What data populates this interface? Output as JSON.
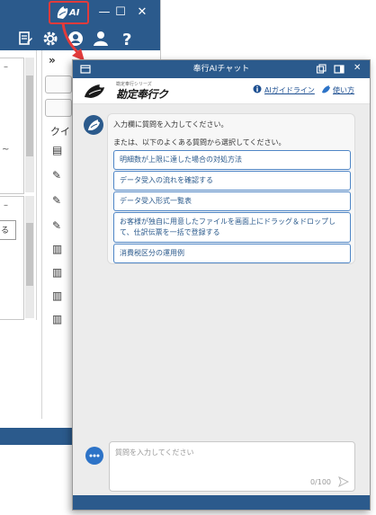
{
  "background_window": {
    "ai_button_label": "AI",
    "nav": {
      "collapse_label": "»",
      "section_label": "クイ"
    },
    "panel": {
      "collapse_mark": "–",
      "tilde_mark": "~",
      "ru_mark": "る"
    },
    "colors": {
      "titlebar": "#2b5a8c",
      "highlight": "#e23b3b"
    }
  },
  "chat_window": {
    "title": "奉行AIチャット",
    "brand": {
      "subtitle": "勘定奉行シリーズ",
      "name": "勘定奉行クラウド"
    },
    "links": {
      "ai_guide": "AIガイドライン",
      "how_to_use": "使い方"
    },
    "bot_message": {
      "intro": "入力欄に質問を入力してください。",
      "or_select": "または、以下のよくある質問から選択してください。",
      "faq": [
        "明細数が上限に達した場合の対処方法",
        "データ受入の流れを確認する",
        "データ受入形式一覧表",
        "お客様が独自に用意したファイルを画面上にドラッグ＆ドロップして、仕訳伝票を一括で登録する",
        "消費税区分の運用例"
      ]
    },
    "input": {
      "placeholder": "質問を入力してください",
      "counter": "0/100"
    },
    "colors": {
      "titlebar": "#2b5a8c",
      "link": "#1d4f91",
      "faq_border": "#4f86c6"
    }
  }
}
